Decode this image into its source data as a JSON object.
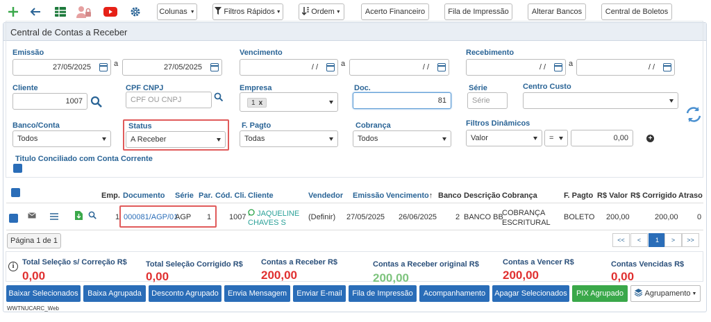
{
  "toolbar": {
    "colunas": "Colunas",
    "filtros_rapidos": "Filtros Rápidos",
    "ordem": "Ordem",
    "acerto_financeiro": "Acerto Financeiro",
    "fila_impressao": "Fila de Impressão",
    "alterar_bancos": "Alterar Bancos",
    "central_boletos": "Central de Boletos"
  },
  "panel": {
    "title": "Central de Contas a Receber"
  },
  "filters": {
    "emissao": {
      "label": "Emissão",
      "from": "27/05/2025",
      "sep": "a",
      "to": "27/05/2025"
    },
    "vencimento": {
      "label": "Vencimento",
      "from": "/ /",
      "sep": "a",
      "to": "/ /"
    },
    "recebimento": {
      "label": "Recebimento",
      "from": "/ /",
      "sep": "a",
      "to": "/ /"
    },
    "cliente": {
      "label": "Cliente",
      "value": "1007"
    },
    "cpf_cnpj": {
      "label": "CPF CNPJ",
      "placeholder": "CPF OU CNPJ"
    },
    "empresa": {
      "label": "Empresa",
      "tag": "1",
      "tag_x": "x"
    },
    "doc": {
      "label": "Doc.",
      "value": "81"
    },
    "serie": {
      "label": "Série",
      "placeholder": "Série"
    },
    "centro_custo": {
      "label": "Centro Custo"
    },
    "banco_conta": {
      "label": "Banco/Conta",
      "value": "Todos"
    },
    "status": {
      "label": "Status",
      "value": "A Receber"
    },
    "f_pagto": {
      "label": "F. Pagto",
      "value": "Todas"
    },
    "cobranca": {
      "label": "Cobrança",
      "value": "Todos"
    },
    "filtros_dinamicos": {
      "label": "Filtros Dinâmicos",
      "field": "Valor",
      "op": "=",
      "value": "0,00"
    },
    "titulo_conciliado": {
      "label": "Titulo Conciliado com Conta Corrente"
    }
  },
  "grid": {
    "headers": {
      "emp": "Emp.",
      "documento": "Documento",
      "serie": "Série",
      "par": "Par.",
      "cod_cli": "Cód. Cli.",
      "cliente": "Cliente",
      "vendedor": "Vendedor",
      "emissao": "Emissão",
      "vencimento": "Vencimento",
      "banco": "Banco",
      "descricao": "Descrição",
      "cobranca": "Cobrança",
      "f_pagto": "F. Pagto",
      "valor": "R$ Valor",
      "corrigido": "R$ Corrigido",
      "atraso": "Atraso"
    },
    "row": {
      "emp": "1",
      "documento": "000081/AGP/01",
      "serie": "AGP",
      "par": "1",
      "cod_cli": "1007",
      "cliente_line1": "JAQUELINE",
      "cliente_line2": "CHAVES S",
      "vendedor": "(Definir)",
      "emissao": "27/05/2025",
      "vencimento": "26/06/2025",
      "banco": "2",
      "descricao": "BANCO BB",
      "cobranca_line1": "COBRANÇA",
      "cobranca_line2": "ESCRITURAL",
      "f_pagto": "BOLETO",
      "valor": "200,00",
      "corrigido": "200,00",
      "atraso": "0"
    }
  },
  "pager": {
    "label": "Página 1 de 1",
    "first": "<<",
    "prev": "<",
    "current": "1",
    "next": ">",
    "last": ">>"
  },
  "totals": {
    "selecao_sem_correcao": {
      "label": "Total Seleção s/ Correção R$",
      "value": "0,00"
    },
    "selecao_corrigido": {
      "label": "Total Seleção Corrigido R$",
      "value": "0,00"
    },
    "contas_receber": {
      "label": "Contas a Receber R$",
      "value": "200,00"
    },
    "contas_receber_original": {
      "label": "Contas a Receber original R$",
      "value": "200,00"
    },
    "contas_vencer": {
      "label": "Contas a Vencer R$",
      "value": "200,00"
    },
    "contas_vencidas": {
      "label": "Contas Vencidas R$",
      "value": "0,00"
    }
  },
  "actions": {
    "baixar_selecionados": "Baixar Selecionados",
    "baixa_agrupada": "Baixa Agrupada",
    "desconto_agrupado": "Desconto Agrupado",
    "envia_mensagem": "Envia Mensagem",
    "enviar_email": "Enviar E-mail",
    "fila_impressao": "Fila de Impressão",
    "acompanhamento": "Acompanhamento",
    "apagar_selecionados": "Apagar Selecionados",
    "pix_agrupado": "PIX Agrupado",
    "agrupamento": "Agrupamento"
  },
  "footer": {
    "program": "WWTNUCARC_Web"
  },
  "colors": {
    "accent": "#2a6db8",
    "label": "#2a6496",
    "red": "#e03030",
    "green": "#3aa84a",
    "highlight": "#e05a5a"
  }
}
